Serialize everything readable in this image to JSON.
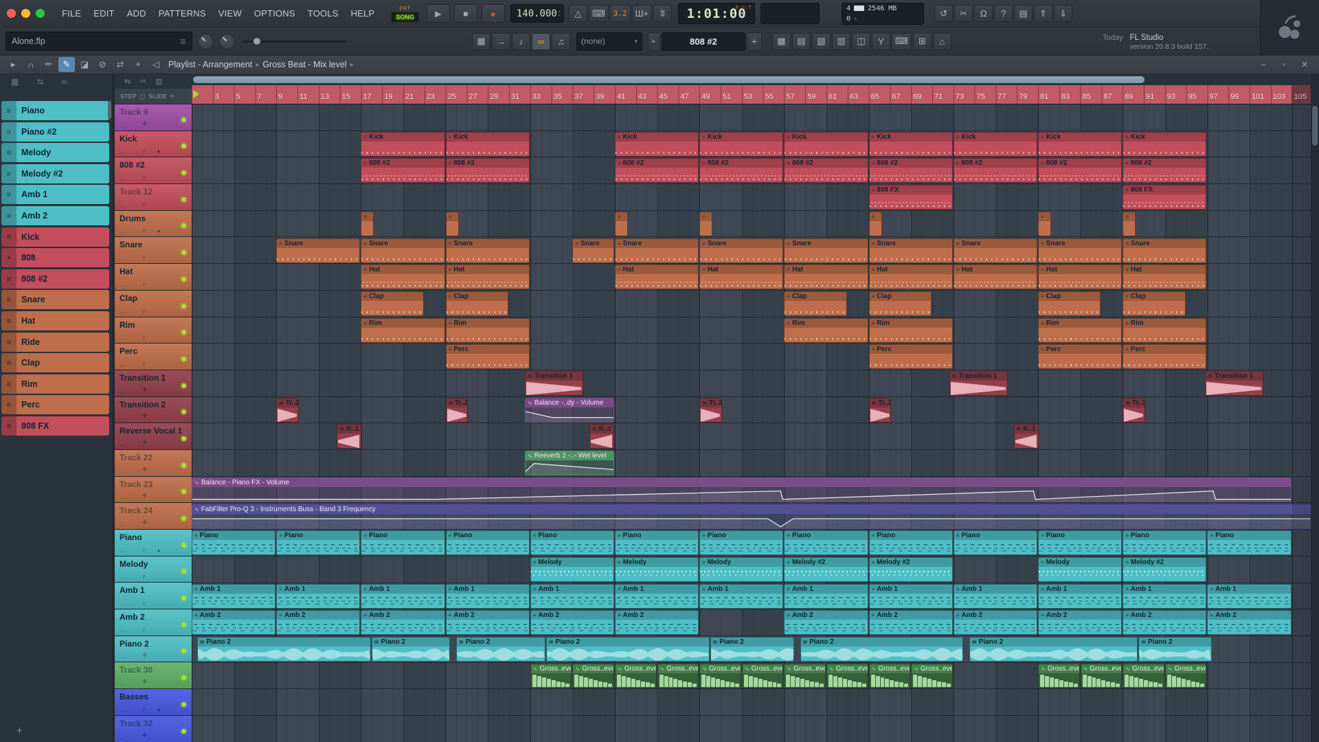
{
  "palette": {
    "teal": "#4FBFC6",
    "red": "#C24F5B",
    "orange": "#BF6E4B",
    "maroon": "#93404C",
    "purple": "#A04FA8",
    "autoPurple": "#7C4A87",
    "indigo": "#555096",
    "autoGreen": "#4E9468",
    "green": "#5FB068",
    "blue": "#4A59E0"
  },
  "glyphs": {
    "play": "▶",
    "stop": "■",
    "rec": "●",
    "up": "▴",
    "down": "▾",
    "caret": "▾",
    "chip": "≡",
    "chipAudio": "•",
    "auto": "∿",
    "audio": "≋",
    "note": "♪",
    "cross": "✛",
    "arrowUp": "▴",
    "dots": "…",
    "minus": "−",
    "box": "▫",
    "close": "✕",
    "listIcon": "≣",
    "patArrow": "▸",
    "plus": "+",
    "sep": "▸"
  },
  "menubar": {
    "menus": [
      "FILE",
      "EDIT",
      "ADD",
      "PATTERNS",
      "VIEW",
      "OPTIONS",
      "TOOLS",
      "HELP"
    ],
    "pat": "PAT",
    "song": "SONG",
    "tempo": "140.000",
    "countdown": "3.2",
    "time": "1:01:00",
    "time_mode": "B:S:T",
    "monitor_top": "4",
    "monitor_mem": "2546 MB",
    "monitor_bottom": "0",
    "icons1": [
      {
        "name": "metronome-icon",
        "g": "△"
      },
      {
        "name": "typing-piano-icon",
        "g": "⌨"
      },
      {
        "name": "countdown-badge",
        "g": "3.2",
        "lcd": true
      },
      {
        "name": "overdub-icon",
        "g": "Ш+"
      },
      {
        "name": "loop-record-icon",
        "g": "ʬ"
      }
    ],
    "icons2": [
      {
        "name": "undo-icon",
        "g": "↺"
      },
      {
        "name": "cut-icon",
        "g": "✂"
      },
      {
        "name": "mic-icon",
        "g": "Ω"
      },
      {
        "name": "help-icon",
        "g": "?"
      },
      {
        "name": "save-icon",
        "g": "▤"
      },
      {
        "name": "export-icon",
        "g": "⇑"
      },
      {
        "name": "render-icon",
        "g": "⇓"
      }
    ]
  },
  "toolbar": {
    "project": "Alone.flp",
    "selector": "(none)",
    "pattern": "808 #2",
    "hint_when": "Today",
    "hint_app": "FL Studio",
    "hint_version": "version 20.8.3 build 157..",
    "icons1": [
      {
        "name": "grid-icon",
        "g": "▦"
      },
      {
        "name": "jump-icon",
        "g": "→"
      },
      {
        "name": "note-icon",
        "g": "♪"
      },
      {
        "name": "link-icon",
        "g": "∞",
        "active": true
      },
      {
        "name": "bell-icon",
        "g": "♫"
      }
    ],
    "panels": [
      {
        "name": "playlist-panel-icon",
        "g": "▦"
      },
      {
        "name": "stepseq-panel-icon",
        "g": "▤"
      },
      {
        "name": "pianoroll-panel-icon",
        "g": "▧"
      },
      {
        "name": "mixer-panel-icon",
        "g": "▥"
      },
      {
        "name": "browser-panel-icon",
        "g": "◫"
      },
      {
        "name": "plugin-picker-icon",
        "g": "Y"
      },
      {
        "name": "touch-keyboard-icon",
        "g": "⌨"
      },
      {
        "name": "tempo-tap-icon",
        "g": "⊞"
      },
      {
        "name": "options-icon",
        "g": "⌂"
      }
    ]
  },
  "playlistbar": {
    "title": "Playlist - Arrangement",
    "subtitle": "Gross Beat - Mix level",
    "sep": "▸",
    "icons": [
      {
        "name": "menu-arrow-icon",
        "g": "▸"
      },
      {
        "name": "magnet-icon",
        "g": "∩"
      },
      {
        "name": "draw-icon",
        "g": "✏"
      },
      {
        "name": "paint-icon",
        "g": "✎",
        "active": true
      },
      {
        "name": "delete-icon",
        "g": "◪"
      },
      {
        "name": "mute-icon",
        "g": "⊘"
      },
      {
        "name": "slip-icon",
        "g": "⇄"
      },
      {
        "name": "zoom-icon",
        "g": "⌖"
      },
      {
        "name": "preview-icon",
        "g": "◁"
      }
    ],
    "win": [
      {
        "name": "minimize-button",
        "g": "−"
      },
      {
        "name": "maximize-button",
        "g": "▫"
      },
      {
        "name": "close-button",
        "g": "✕"
      }
    ]
  },
  "panel": {
    "step": "STEP",
    "slide": "SLIDE"
  },
  "timeline": {
    "labels_from": 3,
    "labels_to": 105,
    "step": 2,
    "song_end": 105
  },
  "picker": [
    {
      "label": "Piano",
      "color": "teal"
    },
    {
      "label": "Piano #2",
      "color": "teal"
    },
    {
      "label": "Melody",
      "color": "teal"
    },
    {
      "label": "Melody #2",
      "color": "teal"
    },
    {
      "label": "Amb 1",
      "color": "teal"
    },
    {
      "label": "Amb 2",
      "color": "teal"
    },
    {
      "label": "Kick",
      "color": "red"
    },
    {
      "label": "808",
      "color": "red",
      "audio": true
    },
    {
      "label": "808 #2",
      "color": "red"
    },
    {
      "label": "Snare",
      "color": "orange"
    },
    {
      "label": "Hat",
      "color": "orange"
    },
    {
      "label": "Ride",
      "color": "orange"
    },
    {
      "label": "Clap",
      "color": "orange"
    },
    {
      "label": "Rim",
      "color": "orange"
    },
    {
      "label": "Perc",
      "color": "orange"
    },
    {
      "label": "808 FX",
      "color": "red"
    }
  ],
  "tracks": [
    {
      "name": "Track 9",
      "color": "purple",
      "dim": true,
      "icon": "cross",
      "clips": []
    },
    {
      "name": "Kick",
      "color": "red",
      "icon": "note",
      "arrow": true,
      "deft": "Kick",
      "defl": 8,
      "defx": "ticks",
      "clips": [
        {
          "s": 17
        },
        {
          "s": 25
        },
        {
          "s": 41
        },
        {
          "s": 49
        },
        {
          "s": 57
        },
        {
          "s": 65
        },
        {
          "s": 73
        },
        {
          "s": 81
        },
        {
          "s": 89
        }
      ]
    },
    {
      "name": "808 #2",
      "color": "red",
      "icon": "note",
      "deft": "808 #2",
      "defl": 8,
      "defx": "dots",
      "clips": [
        {
          "s": 17
        },
        {
          "s": 25
        },
        {
          "s": 41
        },
        {
          "s": 49
        },
        {
          "s": 57
        },
        {
          "s": 65
        },
        {
          "s": 73
        },
        {
          "s": 81
        },
        {
          "s": 89
        }
      ]
    },
    {
      "name": "Track 12",
      "color": "red",
      "dim": true,
      "icon": "note",
      "deft": "808 FX",
      "defl": 8,
      "defx": "dots",
      "clips": [
        {
          "s": 65
        },
        {
          "s": 89
        }
      ]
    },
    {
      "name": "Drums",
      "color": "orange",
      "icon": "note",
      "arrow": true,
      "deft": "",
      "defl": 1.3,
      "clips": [
        {
          "s": 17
        },
        {
          "s": 25
        },
        {
          "s": 41
        },
        {
          "s": 49
        },
        {
          "s": 65
        },
        {
          "s": 81
        },
        {
          "s": 89
        }
      ]
    },
    {
      "name": "Snare",
      "color": "orange",
      "icon": "note",
      "deft": "Snare",
      "defl": 8,
      "defx": "ticks",
      "clips": [
        {
          "s": 9
        },
        {
          "s": 17
        },
        {
          "s": 25
        },
        {
          "s": 37,
          "l": 4
        },
        {
          "s": 41
        },
        {
          "s": 49
        },
        {
          "s": 57
        },
        {
          "s": 65
        },
        {
          "s": 73
        },
        {
          "s": 81
        },
        {
          "s": 89
        }
      ]
    },
    {
      "name": "Hat",
      "color": "orange",
      "icon": "note",
      "deft": "Hat",
      "defl": 8,
      "defx": "dots",
      "clips": [
        {
          "s": 17
        },
        {
          "s": 25
        },
        {
          "s": 41
        },
        {
          "s": 49
        },
        {
          "s": 57
        },
        {
          "s": 65
        },
        {
          "s": 73
        },
        {
          "s": 81
        },
        {
          "s": 89
        }
      ]
    },
    {
      "name": "Clap",
      "color": "orange",
      "icon": "note",
      "deft": "Clap",
      "defl": 6,
      "defx": "ticks",
      "clips": [
        {
          "s": 17
        },
        {
          "s": 25
        },
        {
          "s": 57
        },
        {
          "s": 65
        },
        {
          "s": 81
        },
        {
          "s": 89
        }
      ]
    },
    {
      "name": "Rim",
      "color": "orange",
      "icon": "note",
      "deft": "Rim",
      "defl": 8,
      "defx": "ticks",
      "clips": [
        {
          "s": 17
        },
        {
          "s": 25
        },
        {
          "s": 57
        },
        {
          "s": 65
        },
        {
          "s": 81
        },
        {
          "s": 89
        }
      ]
    },
    {
      "name": "Perc",
      "color": "orange",
      "icon": "note",
      "deft": "Perc",
      "defl": 8,
      "defx": "ticks",
      "clips": [
        {
          "s": 25
        },
        {
          "s": 65
        },
        {
          "s": 81
        },
        {
          "s": 89
        }
      ]
    },
    {
      "name": "Transition 1",
      "color": "maroon",
      "icon": "cross",
      "deft": "Transition 1",
      "defl": 5.6,
      "defk": "aud",
      "defw": "fall",
      "clips": [
        {
          "s": 32.5
        },
        {
          "s": 72.6
        },
        {
          "s": 96.8
        }
      ]
    },
    {
      "name": "Transition 2",
      "color": "maroon",
      "icon": "cross",
      "deft": "Tr..2",
      "defl": 2.2,
      "defk": "aud",
      "defw": "fall",
      "clips": [
        {
          "s": 9
        },
        {
          "s": 25
        },
        {
          "s": 32.5,
          "l": 8.5,
          "k": "auto",
          "c": "autoPurple",
          "t": "Balance -..dy - Volume",
          "pts": [
            [
              0,
              0.78
            ],
            [
              2.5,
              0.3
            ],
            [
              8.5,
              0.3
            ]
          ]
        },
        {
          "s": 49
        },
        {
          "s": 65
        },
        {
          "s": 89
        }
      ]
    },
    {
      "name": "Reverse Vocal 1",
      "color": "maroon",
      "icon": "cross",
      "deft": "R..1",
      "defl": 2.4,
      "defk": "aud",
      "defw": "rise",
      "clips": [
        {
          "s": 14.7
        },
        {
          "s": 38.6
        },
        {
          "s": 78.7
        }
      ]
    },
    {
      "name": "Track 22",
      "color": "orange",
      "dim": true,
      "icon": "cross",
      "clips": [
        {
          "s": 32.5,
          "l": 8.5,
          "k": "auto",
          "c": "autoGreen",
          "t": "Reeverb 2 -..- Wet level",
          "pts": [
            [
              0,
              0.2
            ],
            [
              0.8,
              0.85
            ],
            [
              8.5,
              0.35
            ]
          ]
        }
      ]
    },
    {
      "name": "Track 23",
      "color": "orange",
      "dim": true,
      "icon": "cross",
      "clips": [
        {
          "s": 1,
          "l": 104,
          "k": "auto",
          "c": "autoPurple",
          "t": "Balance - Piano FX - Volume",
          "pts": [
            [
              0,
              0.13
            ],
            [
              23,
              0.13
            ],
            [
              55.6,
              0.8
            ],
            [
              55.8,
              0.12
            ],
            [
              79.5,
              0.8
            ],
            [
              79.7,
              0.12
            ],
            [
              96.5,
              0.8
            ],
            [
              96.7,
              0.13
            ],
            [
              104,
              0.13
            ]
          ]
        }
      ]
    },
    {
      "name": "Track 24",
      "color": "orange",
      "dim": true,
      "icon": "cross",
      "clips": [
        {
          "s": 1,
          "l": 107,
          "k": "auto",
          "c": "indigo",
          "t": "FabFilter Pro-Q 3 - Instruments Buss - Band 3 Frequency",
          "pts": [
            [
              0,
              0.72
            ],
            [
              54.4,
              0.72
            ],
            [
              55.6,
              0.07
            ],
            [
              56.8,
              0.72
            ],
            [
              106,
              0.72
            ]
          ]
        }
      ]
    },
    {
      "name": "Piano",
      "color": "teal",
      "icon": "note",
      "arrow": true,
      "deft": "Piano",
      "defl": 8,
      "defx": "dash",
      "clips": [
        {
          "s": 1
        },
        {
          "s": 9
        },
        {
          "s": 17
        },
        {
          "s": 25
        },
        {
          "s": 33
        },
        {
          "s": 41
        },
        {
          "s": 49
        },
        {
          "s": 57
        },
        {
          "s": 65
        },
        {
          "s": 73
        },
        {
          "s": 81
        },
        {
          "s": 89
        },
        {
          "s": 97
        }
      ]
    },
    {
      "name": "Melody",
      "color": "teal",
      "icon": "note",
      "deft": "Melody",
      "defl": 8,
      "defx": "wdots",
      "clips": [
        {
          "s": 33
        },
        {
          "s": 41
        },
        {
          "s": 49
        },
        {
          "s": 57,
          "t": "Melody #2"
        },
        {
          "s": 65,
          "t": "Melody #2"
        },
        {
          "s": 81
        },
        {
          "s": 89,
          "t": "Melody #2"
        }
      ]
    },
    {
      "name": "Amb 1",
      "color": "teal",
      "icon": "note",
      "deft": "Amb 1",
      "defl": 8,
      "defx": "dash",
      "clips": [
        {
          "s": 1
        },
        {
          "s": 9
        },
        {
          "s": 17
        },
        {
          "s": 25
        },
        {
          "s": 33
        },
        {
          "s": 41
        },
        {
          "s": 49
        },
        {
          "s": 57
        },
        {
          "s": 65
        },
        {
          "s": 73
        },
        {
          "s": 81
        },
        {
          "s": 89
        },
        {
          "s": 97
        }
      ]
    },
    {
      "name": "Amb 2",
      "color": "teal",
      "icon": "note",
      "deft": "Amb 2",
      "defl": 8,
      "defx": "dash",
      "clips": [
        {
          "s": 1
        },
        {
          "s": 9
        },
        {
          "s": 17
        },
        {
          "s": 25
        },
        {
          "s": 33
        },
        {
          "s": 41
        },
        {
          "s": 57
        },
        {
          "s": 65
        },
        {
          "s": 73
        },
        {
          "s": 81
        },
        {
          "s": 89
        },
        {
          "s": 97
        }
      ]
    },
    {
      "name": "Piano 2",
      "color": "teal",
      "icon": "cross",
      "deft": "Piano 2",
      "defk": "aud",
      "defw": "wave",
      "clips": [
        {
          "s": 1.5,
          "l": 16.5
        },
        {
          "s": 18,
          "l": 7.5
        },
        {
          "s": 26,
          "l": 8.5
        },
        {
          "s": 34.5,
          "l": 15.5
        },
        {
          "s": 50,
          "l": 8
        },
        {
          "s": 58.5,
          "l": 15.5
        },
        {
          "s": 74.5,
          "l": 16
        },
        {
          "s": 90.5,
          "l": 7
        }
      ]
    },
    {
      "name": "Track 30",
      "color": "green",
      "dim": true,
      "icon": "cross",
      "deft": "Gross..evel",
      "defl": 4,
      "defk": "step",
      "clips": [
        {
          "s": 33
        },
        {
          "s": 37
        },
        {
          "s": 41
        },
        {
          "s": 45
        },
        {
          "s": 49
        },
        {
          "s": 53
        },
        {
          "s": 57
        },
        {
          "s": 61
        },
        {
          "s": 65
        },
        {
          "s": 69
        },
        {
          "s": 81
        },
        {
          "s": 85
        },
        {
          "s": 89
        },
        {
          "s": 93
        }
      ]
    },
    {
      "name": "Basses",
      "color": "blue",
      "icon": "note",
      "arrow": true,
      "clips": []
    },
    {
      "name": "Track 32",
      "color": "blue",
      "dim": true,
      "icon": "cross",
      "clips": []
    }
  ]
}
